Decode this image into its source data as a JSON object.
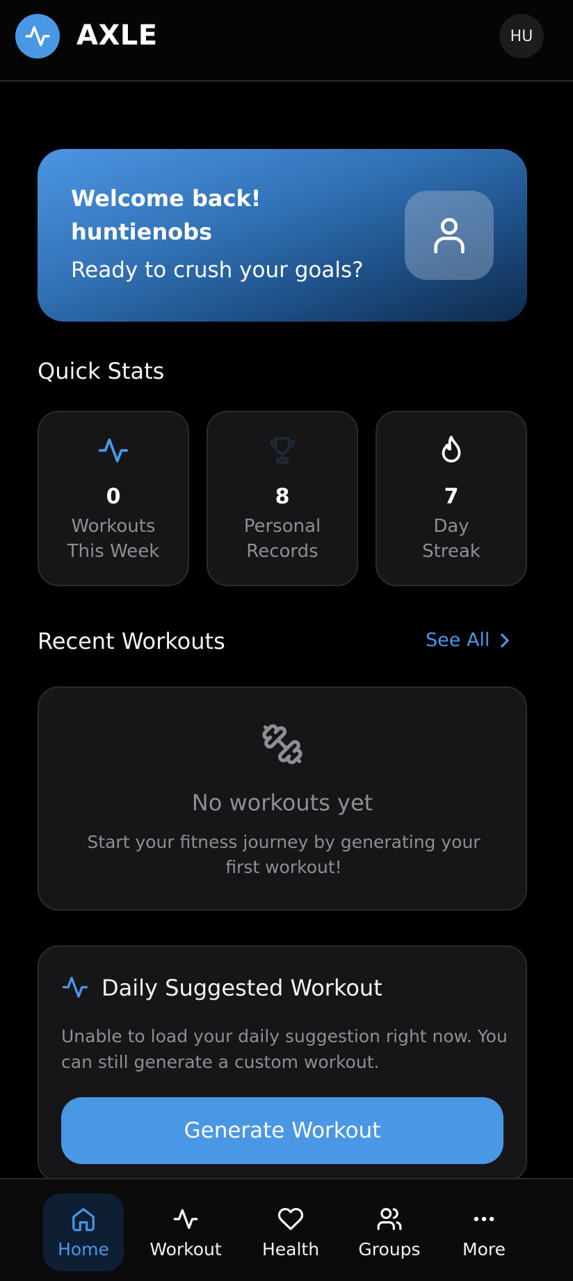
{
  "header": {
    "brand": "AXLE",
    "avatar_initials": "HU",
    "logo_icon": "activity-icon"
  },
  "welcome": {
    "line1": "Welcome back!",
    "username": "huntienobs",
    "tagline": "Ready to crush your goals?",
    "icon": "user-icon"
  },
  "quick_stats": {
    "title": "Quick Stats",
    "items": [
      {
        "value": "0",
        "label_line1": "Workouts",
        "label_line2": "This Week",
        "icon": "activity-icon",
        "icon_color": "#4a97e6"
      },
      {
        "value": "8",
        "label_line1": "Personal",
        "label_line2": "Records",
        "icon": "trophy-icon",
        "icon_color": "#1e2a38"
      },
      {
        "value": "7",
        "label_line1": "Day",
        "label_line2": "Streak",
        "icon": "flame-icon",
        "icon_color": "#ffffff"
      }
    ]
  },
  "recent_workouts": {
    "title": "Recent Workouts",
    "see_all": "See All",
    "empty_title": "No workouts yet",
    "empty_desc": "Start your fitness journey by generating your first workout!",
    "empty_icon": "dumbbell-icon"
  },
  "daily": {
    "title": "Daily Suggested Workout",
    "desc": "Unable to load your daily suggestion right now. You can still generate a custom workout.",
    "button": "Generate Workout",
    "icon": "activity-icon"
  },
  "tabs": [
    {
      "label": "Home",
      "icon": "home-icon",
      "active": true
    },
    {
      "label": "Workout",
      "icon": "activity-icon",
      "active": false
    },
    {
      "label": "Health",
      "icon": "heart-icon",
      "active": false
    },
    {
      "label": "Groups",
      "icon": "users-icon",
      "active": false
    },
    {
      "label": "More",
      "icon": "more-icon",
      "active": false
    }
  ],
  "colors": {
    "accent": "#4a97e6",
    "background": "#000000",
    "card": "#161618",
    "muted_text": "#8e8e93"
  }
}
